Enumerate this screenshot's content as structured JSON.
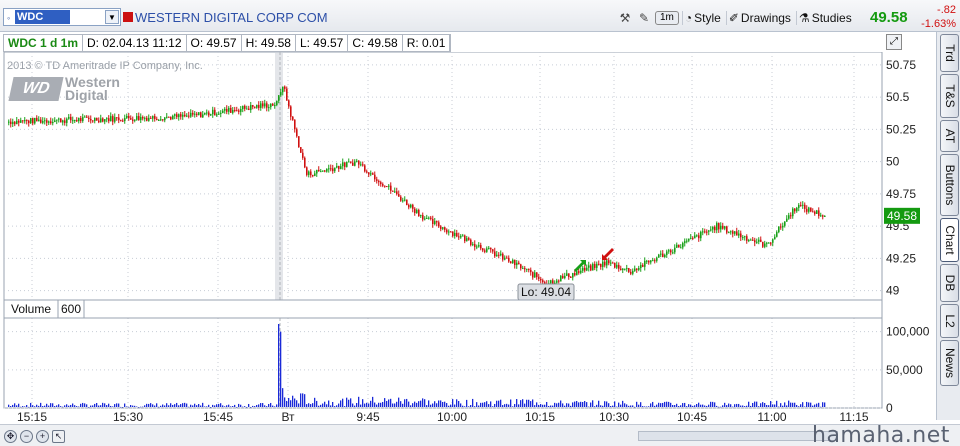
{
  "toolbar": {
    "symbol": "WDC",
    "company_name": "WESTERN DIGITAL CORP COM",
    "aggregation_pill": "1m",
    "style_label": "Style",
    "drawings_label": "Drawings",
    "studies_label": "Studies",
    "last_price": "49.58",
    "change_abs": "-.82",
    "change_pct": "-1.63%",
    "colors": {
      "price_up": "#149a10",
      "price_down": "#d01010"
    },
    "icons": [
      "wrench-icon",
      "pin-icon",
      "style-icon",
      "drawings-icon",
      "studies-icon"
    ]
  },
  "infobar": {
    "study": "WDC 1 d 1m",
    "date": "D: 02.04.13 11:12",
    "open": "O: 49.57",
    "high": "H: 49.58",
    "low": "L: 49.57",
    "close": "C: 49.58",
    "range": "R: 0.01"
  },
  "logo": {
    "copyright": "2013 © TD Ameritrade IP Company, Inc.",
    "mark": "WD",
    "word1": "Western",
    "word2": "Digital"
  },
  "volume_panel": {
    "label": "Volume",
    "value": "600"
  },
  "vtabs": [
    "Trd",
    "T&S",
    "AT",
    "Buttons",
    "Chart",
    "DB",
    "L2",
    "News"
  ],
  "active_tab": "Chart",
  "watermark": "hamaha.net",
  "chart_data": {
    "type": "candlestick",
    "price_axis": {
      "ticks": [
        "50.75",
        "50.5",
        "50.25",
        "50",
        "49.75",
        "49.5",
        "49.25",
        "49"
      ],
      "ylim": [
        48.85,
        50.85
      ]
    },
    "volume_axis": {
      "ticks": [
        "100,000",
        "50,000",
        "0"
      ],
      "ylim": [
        0,
        110000
      ]
    },
    "time_ticks": [
      "15:15",
      "15:30",
      "15:45",
      "Вт",
      "9:45",
      "10:00",
      "10:15",
      "10:30",
      "10:45",
      "11:00",
      "11:15"
    ],
    "current_price_marker": "49.58",
    "low_annotation": "Lo: 49.04",
    "colors": {
      "up": "#18a018",
      "down": "#d01010",
      "volume": "#1a2ad8",
      "grid": "#c8cdd6",
      "session_separator": "#b0b4ba"
    },
    "grid": "dotted",
    "segments": [
      {
        "start": 0,
        "end": 90,
        "from": 50.31,
        "to": 50.35,
        "vol": 4000
      },
      {
        "start": 90,
        "end": 135,
        "from": 50.35,
        "to": 50.45,
        "vol": 4000
      },
      {
        "start": 135,
        "end": 138,
        "from": 50.45,
        "to": 50.6,
        "vol": 99000
      },
      {
        "start": 138,
        "end": 150,
        "from": 50.6,
        "to": 49.9,
        "vol": 12000
      },
      {
        "start": 150,
        "end": 175,
        "from": 49.9,
        "to": 50.0,
        "vol": 8000
      },
      {
        "start": 175,
        "end": 210,
        "from": 50.0,
        "to": 49.55,
        "vol": 9000
      },
      {
        "start": 210,
        "end": 255,
        "from": 49.55,
        "to": 49.2,
        "vol": 7000
      },
      {
        "start": 255,
        "end": 270,
        "from": 49.2,
        "to": 49.06,
        "vol": 8000
      },
      {
        "start": 270,
        "end": 300,
        "from": 49.06,
        "to": 49.22,
        "vol": 6000
      },
      {
        "start": 300,
        "end": 312,
        "from": 49.22,
        "to": 49.15,
        "vol": 6000
      },
      {
        "start": 312,
        "end": 355,
        "from": 49.15,
        "to": 49.5,
        "vol": 5000
      },
      {
        "start": 355,
        "end": 380,
        "from": 49.5,
        "to": 49.35,
        "vol": 5000
      },
      {
        "start": 380,
        "end": 395,
        "from": 49.35,
        "to": 49.66,
        "vol": 6000
      },
      {
        "start": 395,
        "end": 409,
        "from": 49.66,
        "to": 49.58,
        "vol": 5000
      }
    ]
  }
}
